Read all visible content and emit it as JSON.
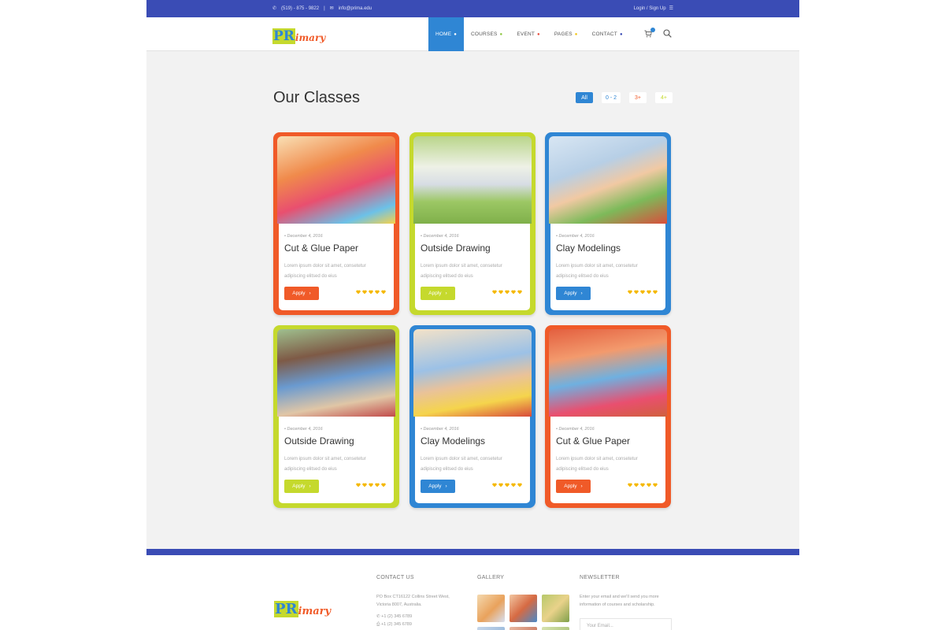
{
  "topbar": {
    "phone": "(519) - 875 - 9822",
    "separator": "|",
    "email": "info@prima.edu",
    "auth": "Login / Sign Up"
  },
  "header": {
    "logo_big": "PR",
    "logo_rest": "imary",
    "nav": [
      {
        "label": "HOME",
        "dot_color": "#ffffff"
      },
      {
        "label": "COURSES",
        "dot_color": "#8cc63f"
      },
      {
        "label": "EVENT",
        "dot_color": "#e74c3c"
      },
      {
        "label": "PAGES",
        "dot_color": "#f1c40f"
      },
      {
        "label": "CONTACT",
        "dot_color": "#3a4cb5"
      }
    ]
  },
  "classes": {
    "title": "Our Classes",
    "filters": [
      {
        "label": "All",
        "color": "#ffffff"
      },
      {
        "label": "0 - 2",
        "color": "#2f86d4"
      },
      {
        "label": "3+",
        "color": "#f05a28"
      },
      {
        "label": "4+",
        "color": "#c5d92d"
      }
    ],
    "cards": [
      {
        "date": "December 4, 2016",
        "title": "Cut & Glue Paper",
        "desc": "Lorem ipsum dolor sit amet, consetetur adipiscing elitsed do eius",
        "apply": "Apply",
        "color": "#f05a28",
        "rating": 5
      },
      {
        "date": "December 4, 2016",
        "title": "Outside Drawing",
        "desc": "Lorem ipsum dolor sit amet, consetetur adipiscing elitsed do eius",
        "apply": "Apply",
        "color": "#c5d92d",
        "rating": 5
      },
      {
        "date": "December 4, 2016",
        "title": "Clay Modelings",
        "desc": "Lorem ipsum dolor sit amet, consetetur adipiscing elitsed do eius",
        "apply": "Apply",
        "color": "#2f86d4",
        "rating": 5
      },
      {
        "date": "December 4, 2016",
        "title": "Outside Drawing",
        "desc": "Lorem ipsum dolor sit amet, consetetur adipiscing elitsed do eius",
        "apply": "Apply",
        "color": "#c5d92d",
        "rating": 5
      },
      {
        "date": "December 4, 2016",
        "title": "Clay Modelings",
        "desc": "Lorem ipsum dolor sit amet, consetetur adipiscing elitsed do eius",
        "apply": "Apply",
        "color": "#2f86d4",
        "rating": 5
      },
      {
        "date": "December 4, 2016",
        "title": "Cut & Glue Paper",
        "desc": "Lorem ipsum dolor sit amet, consetetur adipiscing elitsed do eius",
        "apply": "Apply",
        "color": "#f05a28",
        "rating": 5
      }
    ]
  },
  "footer": {
    "logo_big": "PR",
    "logo_rest": "imary",
    "contact": {
      "title": "CONTACT US",
      "address_1": "PO Box CT16122 Collins Street West,",
      "address_2": "Victoria 8007, Australia.",
      "phone": "+1 (2) 345 6789",
      "fax": "+1 (2) 345 6789"
    },
    "gallery": {
      "title": "GALLERY"
    },
    "newsletter": {
      "title": "NEWSLETTER",
      "text_1": "Enter your email and we'll send you more",
      "text_2": "information of courses and scholarship.",
      "placeholder": "Your Email..."
    }
  },
  "colors": {
    "primary_blue": "#3a4cb5",
    "accent_blue": "#2f86d4",
    "orange": "#f05a28",
    "lime": "#c5d92d",
    "heart": "#f5b800"
  }
}
